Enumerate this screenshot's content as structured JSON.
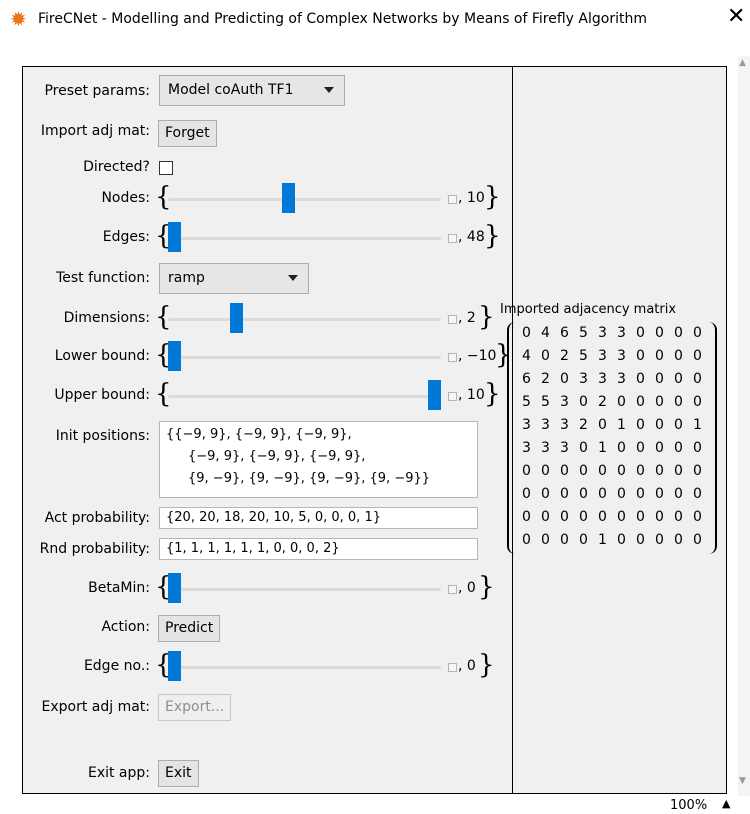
{
  "window": {
    "title": "FireCNet - Modelling and Predicting of Complex Networks by Means of Firefly Algorithm",
    "close_glyph": "✕",
    "app_icon": "gear-icon"
  },
  "controls": {
    "preset": {
      "label": "Preset params:",
      "value": "Model coAuth TF1"
    },
    "import": {
      "label": "Import adj mat:",
      "button": "Forget"
    },
    "directed": {
      "label": "Directed?",
      "checked": false
    },
    "nodes": {
      "label": "Nodes:",
      "value": "10",
      "level": 0.44
    },
    "edges": {
      "label": "Edges:",
      "value": "48",
      "level": 0.0
    },
    "test_function": {
      "label": "Test function:",
      "value": "ramp"
    },
    "dimensions": {
      "label": "Dimensions:",
      "value": "2",
      "level": 0.24
    },
    "lower_bound": {
      "label": "Lower bound:",
      "value": "−10",
      "level": 0.0
    },
    "upper_bound": {
      "label": "Upper bound:",
      "value": "10",
      "level": 1.0
    },
    "init_positions": {
      "label": "Init positions:",
      "lines": [
        "{{−9, 9}, {−9, 9}, {−9, 9},",
        "{−9, 9}, {−9, 9}, {−9, 9},",
        "{9, −9}, {9, −9}, {9, −9}, {9, −9}}"
      ]
    },
    "act_probability": {
      "label": "Act probability:",
      "value": "{20, 20, 18, 20, 10, 5, 0, 0, 0, 1}"
    },
    "rnd_probability": {
      "label": "Rnd probability:",
      "value": "{1, 1, 1, 1, 1, 1, 0, 0, 0, 2}"
    },
    "beta_min": {
      "label": "BetaMin:",
      "value": "0",
      "level": 0.0
    },
    "action": {
      "label": "Action:",
      "button": "Predict"
    },
    "edge_no": {
      "label": "Edge no.:",
      "value": "0",
      "level": 0.0
    },
    "export": {
      "label": "Export adj mat:",
      "button": "Export..."
    },
    "exit": {
      "label": "Exit app:",
      "button": "Exit"
    }
  },
  "matrix": {
    "title": "Imported adjacency matrix",
    "rows": [
      [
        "0",
        "4",
        "6",
        "5",
        "3",
        "3",
        "0",
        "0",
        "0",
        "0"
      ],
      [
        "4",
        "0",
        "2",
        "5",
        "3",
        "3",
        "0",
        "0",
        "0",
        "0"
      ],
      [
        "6",
        "2",
        "0",
        "3",
        "3",
        "3",
        "0",
        "0",
        "0",
        "0"
      ],
      [
        "5",
        "5",
        "3",
        "0",
        "2",
        "0",
        "0",
        "0",
        "0",
        "0"
      ],
      [
        "3",
        "3",
        "3",
        "2",
        "0",
        "1",
        "0",
        "0",
        "0",
        "1"
      ],
      [
        "3",
        "3",
        "3",
        "0",
        "1",
        "0",
        "0",
        "0",
        "0",
        "0"
      ],
      [
        "0",
        "0",
        "0",
        "0",
        "0",
        "0",
        "0",
        "0",
        "0",
        "0"
      ],
      [
        "0",
        "0",
        "0",
        "0",
        "0",
        "0",
        "0",
        "0",
        "0",
        "0"
      ],
      [
        "0",
        "0",
        "0",
        "0",
        "0",
        "0",
        "0",
        "0",
        "0",
        "0"
      ],
      [
        "0",
        "0",
        "0",
        "0",
        "1",
        "0",
        "0",
        "0",
        "0",
        "0"
      ]
    ]
  },
  "status": {
    "zoom": "100%"
  }
}
